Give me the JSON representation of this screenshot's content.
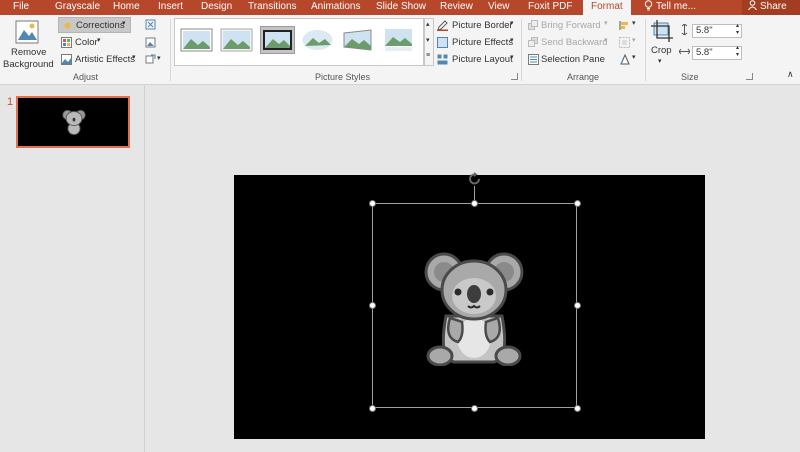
{
  "tabs": [
    {
      "label": "File",
      "active": false
    },
    {
      "label": "Grayscale",
      "active": false
    },
    {
      "label": "Home",
      "active": false
    },
    {
      "label": "Insert",
      "active": false
    },
    {
      "label": "Design",
      "active": false
    },
    {
      "label": "Transitions",
      "active": false
    },
    {
      "label": "Animations",
      "active": false
    },
    {
      "label": "Slide Show",
      "active": false
    },
    {
      "label": "Review",
      "active": false
    },
    {
      "label": "View",
      "active": false
    },
    {
      "label": "Foxit PDF",
      "active": false
    },
    {
      "label": "Format",
      "active": true
    }
  ],
  "tell_me": "Tell me...",
  "share": "Share",
  "ribbon": {
    "adjust": {
      "remove_background_line1": "Remove",
      "remove_background_line2": "Background",
      "corrections": "Corrections",
      "color": "Color",
      "artistic_effects": "Artistic Effects",
      "group_label": "Adjust"
    },
    "picture_styles": {
      "group_label": "Picture Styles",
      "picture_border": "Picture Border",
      "picture_effects": "Picture Effects",
      "picture_layout": "Picture Layout",
      "selected_index": 2
    },
    "arrange": {
      "bring_forward": "Bring Forward",
      "send_backward": "Send Backward",
      "selection_pane": "Selection Pane",
      "group_label": "Arrange"
    },
    "size": {
      "crop": "Crop",
      "height": "5.8\"",
      "width": "5.8\"",
      "group_label": "Size"
    }
  },
  "thumbnails": [
    {
      "number": "1",
      "selected": true
    }
  ],
  "colors": {
    "accent": "#b7472a",
    "ribbon_bg": "#f4f4f4",
    "canvas_bg": "#e6e6e6",
    "slide_bg": "#000000"
  }
}
